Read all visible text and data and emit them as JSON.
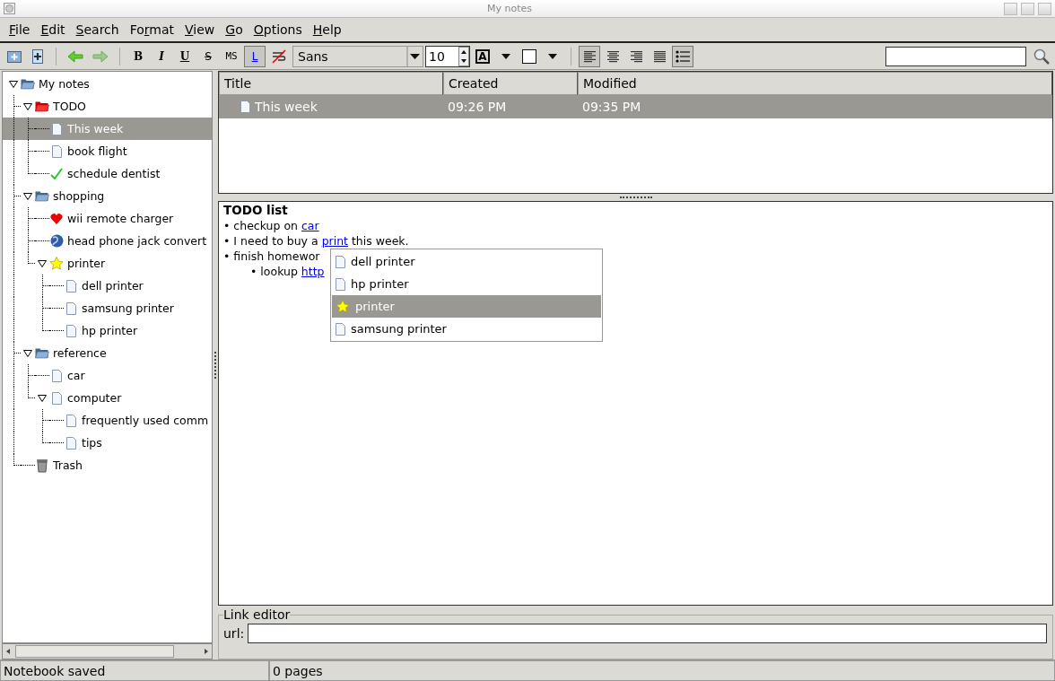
{
  "window": {
    "title": "My notes"
  },
  "menu": [
    {
      "key": "F",
      "post": "ile"
    },
    {
      "key": "E",
      "post": "dit"
    },
    {
      "key": "S",
      "post": "earch"
    },
    {
      "pre": "Fo",
      "key": "r",
      "post": "mat"
    },
    {
      "key": "V",
      "post": "iew"
    },
    {
      "key": "G",
      "post": "o"
    },
    {
      "key": "O",
      "post": "ptions"
    },
    {
      "key": "H",
      "post": "elp"
    }
  ],
  "toolbar": [
    {
      "kind": "notebook"
    },
    {
      "kind": "note"
    },
    {
      "kind": "separator"
    },
    {
      "kind": "back"
    },
    {
      "kind": "forward"
    },
    {
      "kind": "separator"
    },
    {
      "kind": "bold",
      "label": "B",
      "pressed": false
    },
    {
      "kind": "italic",
      "label": "I",
      "pressed": false
    },
    {
      "kind": "underline",
      "label": "U",
      "pressed": false
    },
    {
      "kind": "strike",
      "label": "S",
      "pressed": false
    },
    {
      "kind": "mono",
      "label": "MS",
      "pressed": false
    },
    {
      "kind": "link",
      "label": "L",
      "pressed": true
    },
    {
      "kind": "nowrap",
      "pressed": false
    },
    {
      "kind": "font",
      "value": "Sans"
    },
    {
      "kind": "size",
      "value": "10"
    },
    {
      "kind": "fontcolor",
      "label": "A"
    },
    {
      "kind": "fillcolor"
    },
    {
      "kind": "separator"
    },
    {
      "kind": "alignleft",
      "pressed": true
    },
    {
      "kind": "aligncenter",
      "pressed": false
    },
    {
      "kind": "alignright",
      "pressed": false
    },
    {
      "kind": "justify",
      "pressed": false
    },
    {
      "kind": "bullets",
      "pressed": true
    }
  ],
  "tree": [
    {
      "label": "My notes",
      "kind": "folder",
      "expanded": true,
      "selected": false,
      "children": [
        {
          "label": "TODO",
          "kind": "redfolder",
          "expanded": true,
          "selected": false,
          "children": [
            {
              "label": "This week",
              "kind": "page",
              "selected": true
            },
            {
              "label": "book flight",
              "kind": "page",
              "selected": false
            },
            {
              "label": "schedule dentist",
              "kind": "check",
              "selected": false
            }
          ]
        },
        {
          "label": "shopping",
          "kind": "folder",
          "expanded": true,
          "selected": false,
          "children": [
            {
              "label": "wii remote charger",
              "kind": "heart",
              "selected": false
            },
            {
              "label": "head phone jack convert",
              "kind": "globe",
              "selected": false
            },
            {
              "label": "printer",
              "kind": "star",
              "expanded": true,
              "selected": false,
              "children": [
                {
                  "label": "dell printer",
                  "kind": "page",
                  "selected": false
                },
                {
                  "label": "samsung printer",
                  "kind": "page",
                  "selected": false
                },
                {
                  "label": "hp printer",
                  "kind": "page",
                  "selected": false
                }
              ]
            }
          ]
        },
        {
          "label": "reference",
          "kind": "folder",
          "expanded": true,
          "selected": false,
          "children": [
            {
              "label": "car",
              "kind": "page",
              "selected": false
            },
            {
              "label": "computer",
              "kind": "page",
              "expanded": true,
              "selected": false,
              "children": [
                {
                  "label": "frequently used comm",
                  "kind": "page",
                  "selected": false
                },
                {
                  "label": "tips",
                  "kind": "page",
                  "selected": false
                }
              ]
            }
          ]
        },
        {
          "label": "Trash",
          "kind": "trash",
          "selected": false
        }
      ]
    }
  ],
  "note_list": {
    "columns": [
      "Title",
      "Created",
      "Modified"
    ],
    "rows": [
      {
        "title": "This week",
        "created": "09:26 PM",
        "modified": "09:35 PM",
        "selected": true
      }
    ]
  },
  "editor": {
    "heading": "TODO list",
    "items": [
      {
        "bullet": "•",
        "parts": [
          {
            "text": "checkup on ",
            "link": false
          },
          {
            "text": "car",
            "link": true
          }
        ]
      },
      {
        "bullet": "•",
        "parts": [
          {
            "text": "I need to buy a ",
            "link": false
          },
          {
            "text": "print",
            "link": true
          },
          {
            "text": " this week.",
            "link": false
          }
        ]
      },
      {
        "bullet": "•",
        "parts": [
          {
            "text": "finish homewor",
            "link": false
          }
        ],
        "children": [
          {
            "bullet": "•",
            "parts": [
              {
                "text": "lookup ",
                "link": false
              },
              {
                "text": "http",
                "link": true
              }
            ]
          }
        ]
      }
    ],
    "popup": [
      {
        "label": "dell printer",
        "kind": "page",
        "selected": false
      },
      {
        "label": "hp printer",
        "kind": "page",
        "selected": false
      },
      {
        "label": "printer",
        "kind": "star",
        "selected": true
      },
      {
        "label": "samsung printer",
        "kind": "page",
        "selected": false
      }
    ]
  },
  "link_editor": {
    "title": "Link editor",
    "label": "url:"
  },
  "status_bar": [
    "Notebook saved",
    "0 pages"
  ]
}
